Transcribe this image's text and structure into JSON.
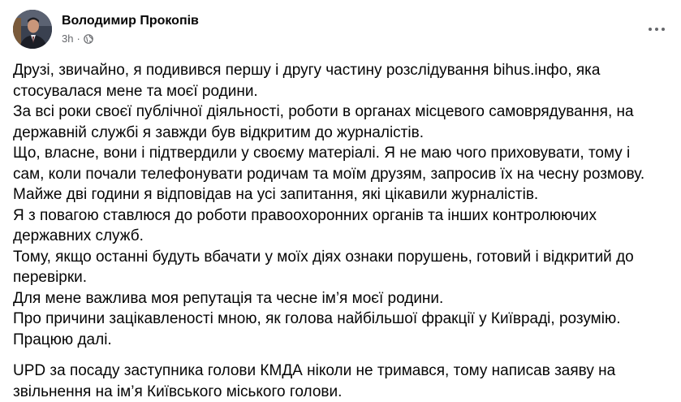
{
  "post": {
    "author": "Володимир Прокопів",
    "time": "3h",
    "separator": "·",
    "privacy_icon": "globe-icon",
    "more_icon": "more-options-icon",
    "paragraphs": [
      "Друзі, звичайно, я подивився першу і другу частину розслідування bihus.інфо, яка стосувалася мене та моєї родини.",
      "За всі роки своєї публічної діяльності, роботи в органах місцевого самоврядування, на державній службі я завжди був відкритим до журналістів.",
      "Що, власне, вони і підтвердили у своєму матеріалі. Я не маю чого приховувати, тому і сам, коли почали телефонувати родичам та моїм друзям, запросив їх на чесну розмову. Майже дві години я відповідав на усі запитання, які цікавили журналістів.",
      "Я з повагою ставлюся до роботи правоохоронних органів та інших контролюючих державних служб.",
      "Тому, якщо останні будуть вбачати у моїх діях ознаки порушень, готовий і відкритий до перевірки.",
      "Для мене важлива моя репутація та чесне ім’я моєї родини.",
      "Про причини зацікавленості мною, як голова найбільшої фракції у Київраді, розумію.",
      "Працюю далі."
    ],
    "update": "UPD за посаду заступника голови КМДА ніколи не тримався, тому написав заяву на звільнення на ім’я Київського міського голови."
  },
  "colors": {
    "text": "#050505",
    "secondary": "#65676b",
    "background": "#ffffff"
  }
}
